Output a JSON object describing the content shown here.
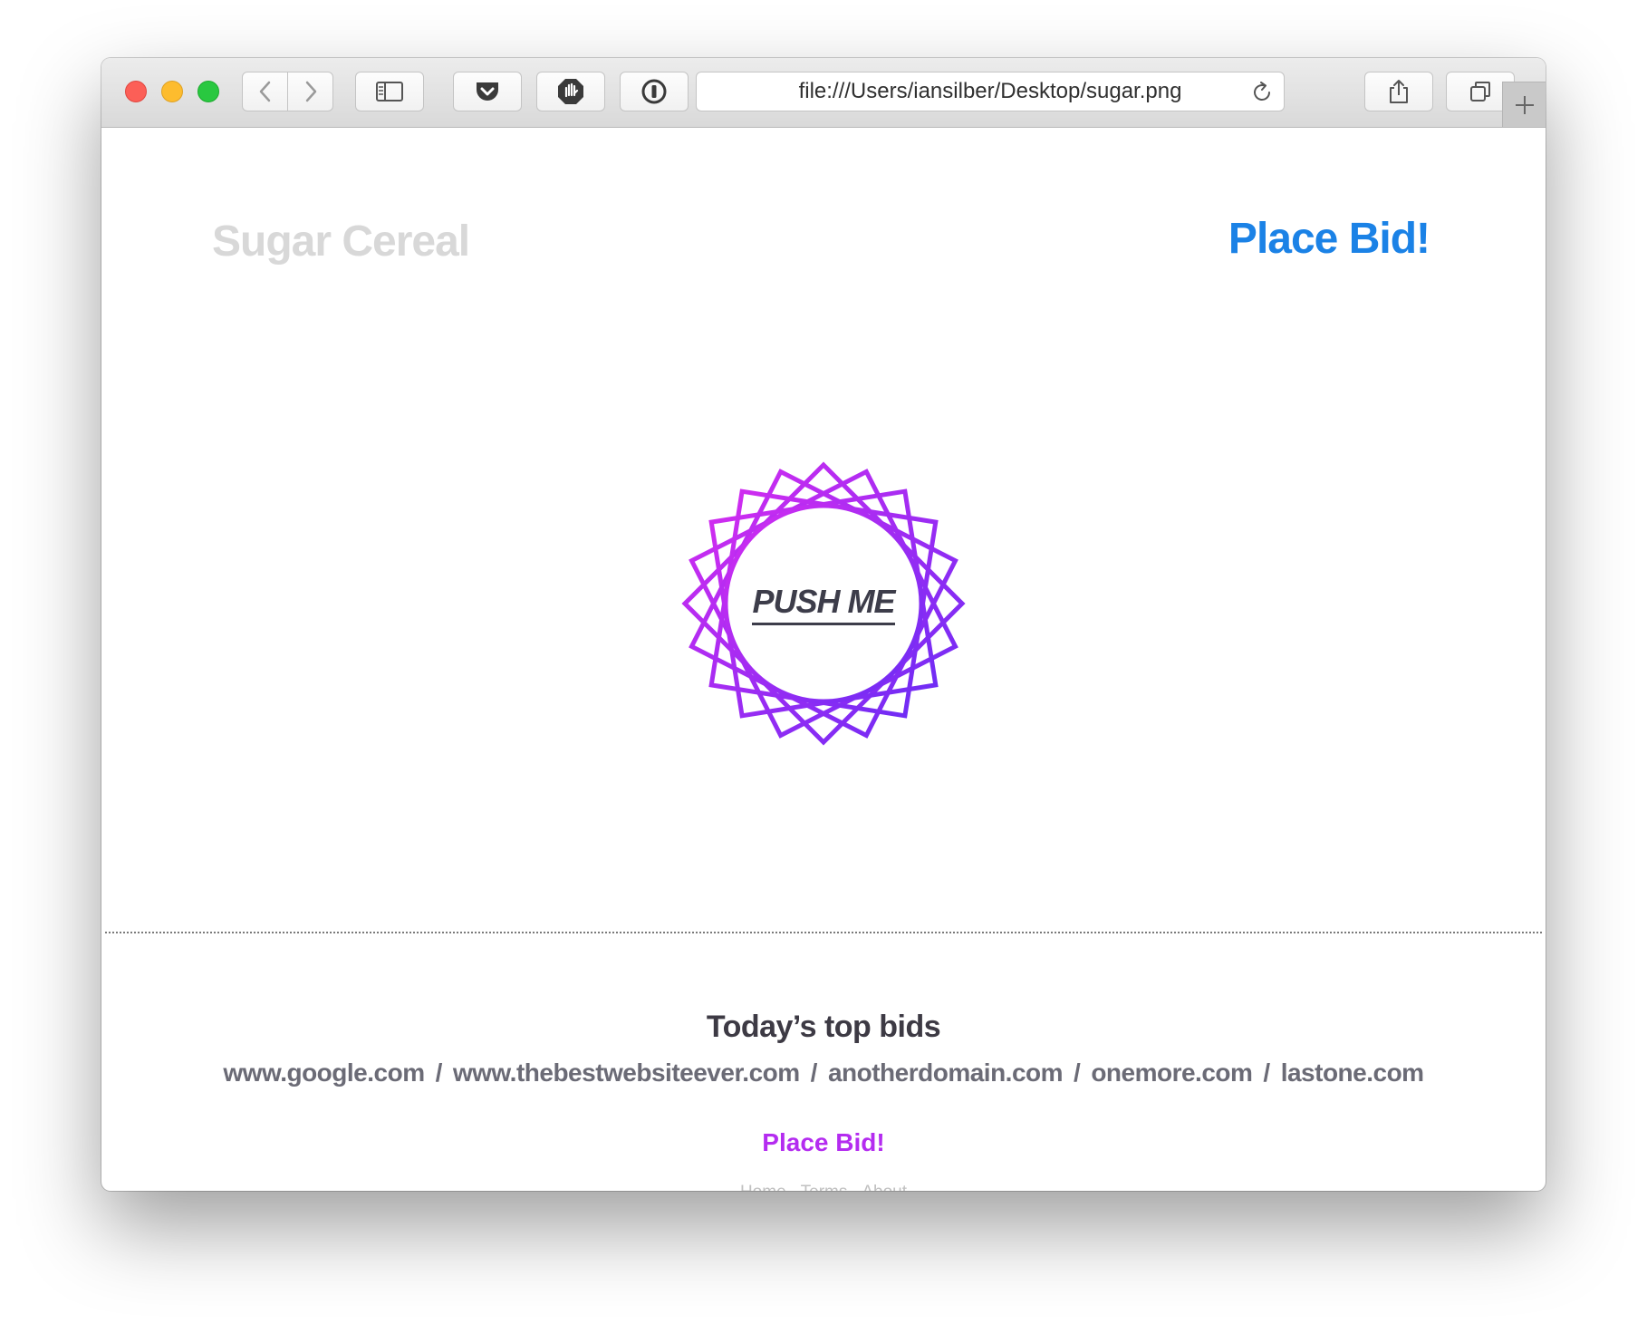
{
  "browser": {
    "url": "file:///Users/iansilber/Desktop/sugar.png"
  },
  "page": {
    "brand": "Sugar Cereal",
    "place_bid_top": "Place Bid!",
    "push_button": "PUSH ME",
    "top_bids_heading": "Today’s top bids",
    "domains": [
      "www.google.com",
      "www.thebestwebsiteever.com",
      "anotherdomain.com",
      "onemore.com",
      "lastone.com"
    ],
    "domain_separator": "/",
    "place_bid_bottom": "Place Bid!",
    "footer_links": [
      "Home",
      "Terms",
      "About"
    ]
  },
  "colors": {
    "accent_blue": "#1b82e6",
    "accent_purple": "#b42cf0",
    "badge_gradient_start": "#d62cf0",
    "badge_gradient_end": "#6a2cf5"
  }
}
